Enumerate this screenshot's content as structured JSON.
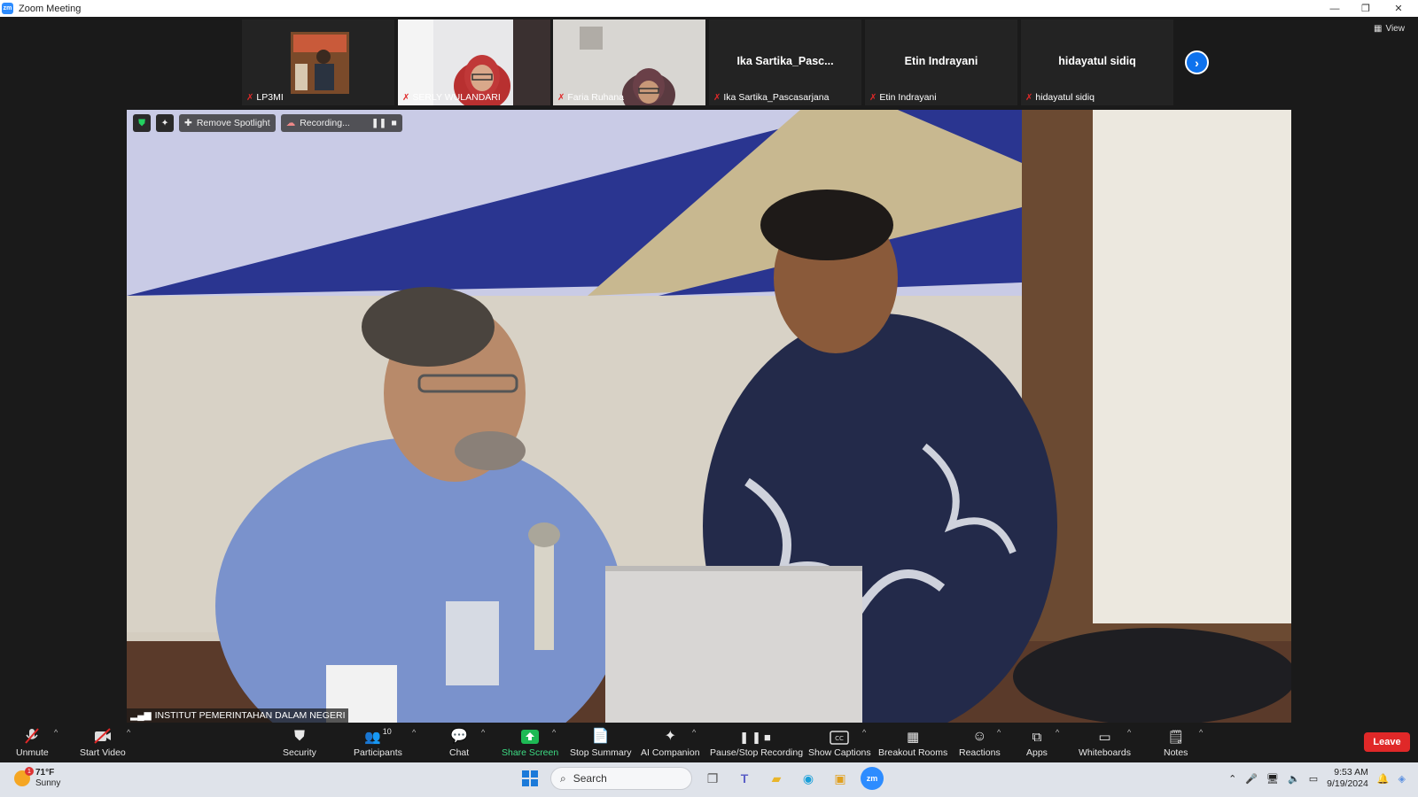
{
  "window": {
    "title": "Zoom Meeting",
    "controls": {
      "minimize": "—",
      "restore": "❐",
      "close": "✕"
    }
  },
  "gallery": {
    "participants": [
      {
        "name": "LP3MI",
        "display": "",
        "video": true
      },
      {
        "name": "SERLY WULANDARI",
        "display": "",
        "video": true
      },
      {
        "name": "Faria Ruhana",
        "display": "",
        "video": true
      },
      {
        "name": "Ika Sartika_Pascasarjana",
        "display": "Ika  Sartika_Pasc...",
        "video": false
      },
      {
        "name": "Etin Indrayani",
        "display": "Etin Indrayani",
        "video": false
      },
      {
        "name": "hidayatul sidiq",
        "display": "hidayatul sidiq",
        "video": false
      }
    ],
    "view_label": "View"
  },
  "overlay": {
    "spotlight_label": "Remove Spotlight",
    "recording_label": "Recording..."
  },
  "speaker_label": "INSTITUT PEMERINTAHAN DALAM NEGERI",
  "toolbar": {
    "items": [
      {
        "label": "Unmute",
        "icon": "mic-off-icon"
      },
      {
        "label": "Start Video",
        "icon": "video-off-icon"
      },
      {
        "label": "Security",
        "icon": "shield-icon"
      },
      {
        "label": "Participants",
        "icon": "participants-icon",
        "count": "10"
      },
      {
        "label": "Chat",
        "icon": "chat-icon"
      },
      {
        "label": "Share Screen",
        "icon": "share-screen-icon"
      },
      {
        "label": "Stop Summary",
        "icon": "summary-icon"
      },
      {
        "label": "AI Companion",
        "icon": "ai-companion-icon"
      },
      {
        "label": "Pause/Stop Recording",
        "icon": "recording-icon"
      },
      {
        "label": "Show Captions",
        "icon": "captions-icon"
      },
      {
        "label": "Breakout Rooms",
        "icon": "breakout-rooms-icon"
      },
      {
        "label": "Reactions",
        "icon": "reactions-icon"
      },
      {
        "label": "Apps",
        "icon": "apps-icon"
      },
      {
        "label": "Whiteboards",
        "icon": "whiteboard-icon"
      },
      {
        "label": "Notes",
        "icon": "notes-icon"
      }
    ],
    "leave_label": "Leave",
    "share_color": "#1db954",
    "leave_color": "#e02828"
  },
  "taskbar": {
    "weather": {
      "temp": "71°F",
      "condition": "Sunny",
      "badge": "1"
    },
    "search_placeholder": "Search",
    "time": "9:53 AM",
    "date": "9/19/2024"
  }
}
